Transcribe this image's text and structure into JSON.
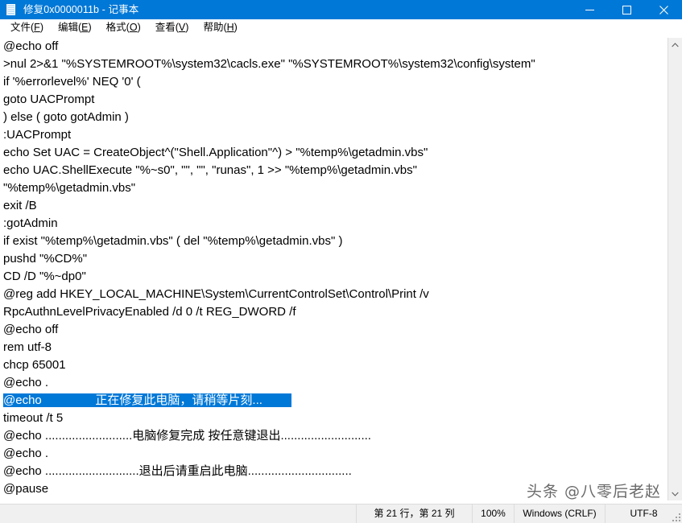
{
  "window": {
    "title": "修复0x0000011b - 记事本",
    "icon": "notepad-icon",
    "accent_color": "#0078D7",
    "controls": {
      "minimize": "—",
      "maximize": "▢",
      "close": "✕"
    }
  },
  "menubar": {
    "items": [
      {
        "label": "文件(F)",
        "pre": "文件(",
        "accel": "F",
        "post": ")"
      },
      {
        "label": "编辑(E)",
        "pre": "编辑(",
        "accel": "E",
        "post": ")"
      },
      {
        "label": "格式(O)",
        "pre": "格式(",
        "accel": "O",
        "post": ")"
      },
      {
        "label": "查看(V)",
        "pre": "查看(",
        "accel": "V",
        "post": ")"
      },
      {
        "label": "帮助(H)",
        "pre": "帮助(",
        "accel": "H",
        "post": ")"
      }
    ]
  },
  "editor": {
    "selection_color": "#0078D7",
    "selected_line_index": 20,
    "lines": [
      "@echo off",
      ">nul 2>&1 \"%SYSTEMROOT%\\system32\\cacls.exe\" \"%SYSTEMROOT%\\system32\\config\\system\"",
      "if '%errorlevel%' NEQ '0' (",
      "goto UACPrompt",
      ") else ( goto gotAdmin )",
      ":UACPrompt",
      "echo Set UAC = CreateObject^(\"Shell.Application\"^) > \"%temp%\\getadmin.vbs\"",
      "echo UAC.ShellExecute \"%~s0\", \"\", \"\", \"runas\", 1 >> \"%temp%\\getadmin.vbs\"",
      "\"%temp%\\getadmin.vbs\"",
      "exit /B",
      ":gotAdmin",
      "if exist \"%temp%\\getadmin.vbs\" ( del \"%temp%\\getadmin.vbs\" )",
      "pushd \"%CD%\"",
      "CD /D \"%~dp0\"",
      "@reg add HKEY_LOCAL_MACHINE\\System\\CurrentControlSet\\Control\\Print /v",
      "RpcAuthnLevelPrivacyEnabled /d 0 /t REG_DWORD /f",
      "@echo off",
      "rem utf-8",
      "chcp 65001",
      "@echo .",
      "@echo                正在修复此电脑，请稍等片刻...",
      "timeout /t 5",
      "@echo ..........................电脑修复完成 按任意键退出...........................",
      "@echo .",
      "@echo ............................退出后请重启此电脑...............................",
      "@pause"
    ]
  },
  "scrollbar": {
    "up_arrow": "⌃",
    "down_arrow": "⌄"
  },
  "statusbar": {
    "position": "第 21 行，第 21 列",
    "zoom": "100%",
    "line_ending": "Windows (CRLF)",
    "encoding": "UTF-8"
  },
  "watermark": {
    "text": "头条 @八零后老赵"
  }
}
